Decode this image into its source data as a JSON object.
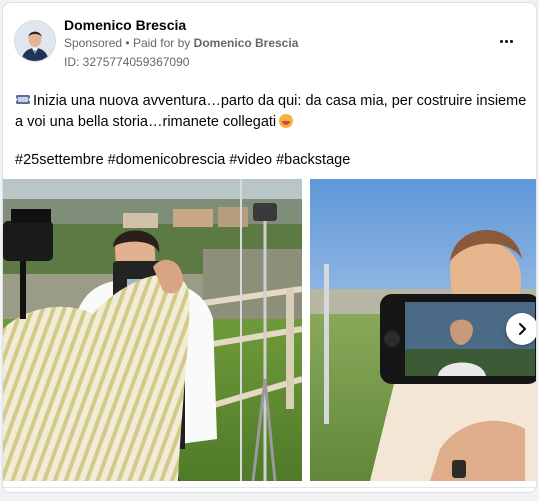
{
  "post": {
    "page_name": "Domenico Brescia",
    "sponsored_label": "Sponsored",
    "separator": "•",
    "paid_for_prefix": "Paid for by",
    "paid_for_name": "Domenico Brescia",
    "ad_id": "ID: 3275774059367090",
    "body_text": "Inizia una nuova avventura…parto da qui: da casa mia, per costruire insieme a voi una bella storia…rimanete collegati",
    "hashtags": [
      "#25settembre",
      "#domenicobrescia",
      "#video",
      "#backstage"
    ]
  },
  "icons": {
    "more": "more-options-icon",
    "leading": "ticket-icon",
    "trailing": "grinning-face-emoji-icon",
    "next": "chevron-right-icon"
  },
  "colors": {
    "text_primary": "#050505",
    "text_secondary": "#65676b",
    "card_background": "#ffffff",
    "page_background": "#f0f2f5"
  }
}
